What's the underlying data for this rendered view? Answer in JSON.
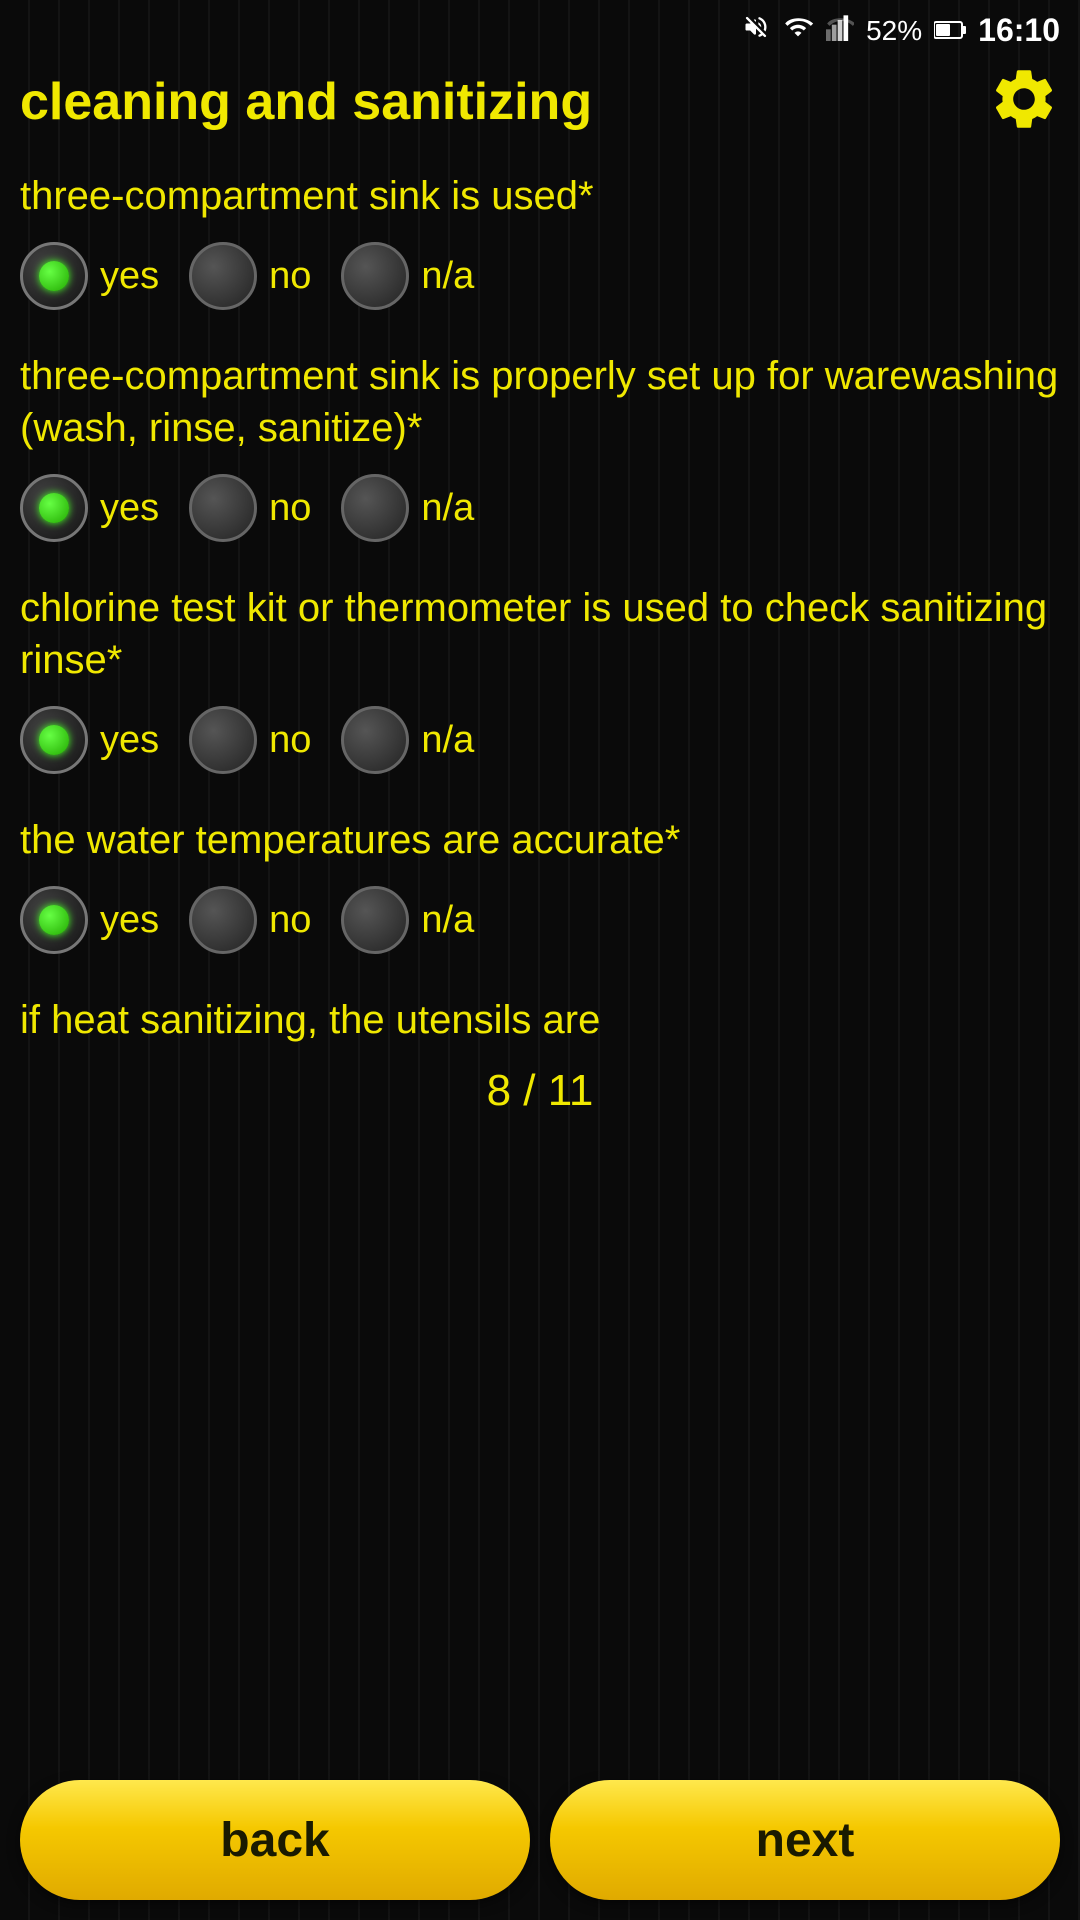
{
  "status_bar": {
    "battery": "52%",
    "time": "16:10"
  },
  "header": {
    "title": "cleaning and sanitizing",
    "settings_icon": "gear-icon"
  },
  "questions": [
    {
      "id": "q1",
      "label": "three-compartment sink is used*",
      "options": [
        "yes",
        "no",
        "n/a"
      ],
      "selected": "yes"
    },
    {
      "id": "q2",
      "label": "three-compartment sink is properly set up for warewashing (wash, rinse, sanitize)*",
      "options": [
        "yes",
        "no",
        "n/a"
      ],
      "selected": "yes"
    },
    {
      "id": "q3",
      "label": "chlorine test kit or thermometer is used to check sanitizing rinse*",
      "options": [
        "yes",
        "no",
        "n/a"
      ],
      "selected": "yes"
    },
    {
      "id": "q4",
      "label": "the water temperatures are accurate*",
      "options": [
        "yes",
        "no",
        "n/a"
      ],
      "selected": "yes"
    }
  ],
  "partial_question": "if heat sanitizing, the utensils are",
  "pagination": {
    "current": 8,
    "total": 11,
    "display": "8 / 11"
  },
  "buttons": {
    "back": "back",
    "next": "next"
  }
}
